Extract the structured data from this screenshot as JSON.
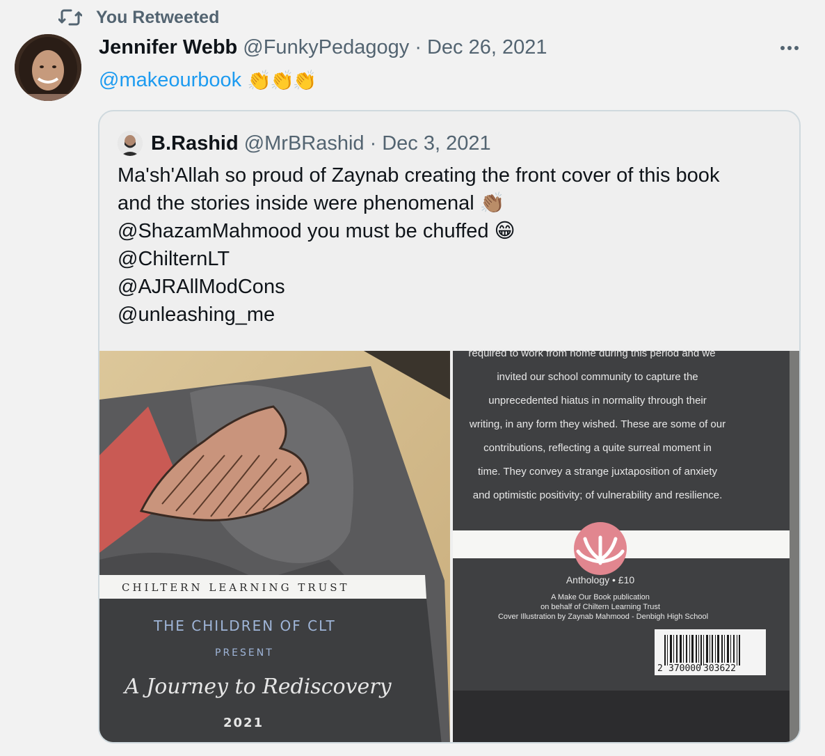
{
  "retweet": {
    "label": "You Retweeted",
    "icon": "retweet-icon"
  },
  "tweet": {
    "author_name": "Jennifer Webb",
    "author_handle": "@FunkyPedagogy",
    "separator": "·",
    "date": "Dec 26, 2021",
    "mention": "@makeourbook",
    "emoji": "👏👏👏",
    "more_icon": "ellipsis-icon"
  },
  "quote": {
    "author_name": "B.Rashid",
    "author_handle": "@MrBRashid",
    "separator": "·",
    "date": "Dec 3, 2021",
    "lines": [
      "Ma'sh'Allah so proud of Zaynab creating the front cover of this book",
      "and the stories inside were phenomenal 👏🏽",
      "@ShazamMahmood you must be chuffed 😁",
      "@ChilternLT",
      "@AJRAllModCons",
      "@unleashing_me"
    ]
  },
  "book_front": {
    "trust": "CHILTERN LEARNING TRUST",
    "line1": "THE CHILDREN OF CLT",
    "line2": "PRESENT",
    "title": "A Journey to Rediscovery",
    "year": "2021"
  },
  "book_back": {
    "blurb": [
      "required to work from home during this period and we",
      "invited our school community to capture the",
      "unprecedented hiatus in normality through their",
      "writing, in any form they wished. These are some of our",
      "contributions, reflecting a quite surreal moment in",
      "time. They convey a strange juxtaposition of anxiety",
      "and optimistic positivity; of vulnerability and resilience."
    ],
    "anthology": "Anthology • £10",
    "pub1": "A Make Our Book publication",
    "pub2": "on behalf of Chiltern Learning Trust",
    "pub3": "Cover Illustration by Zaynab Mahmood - Denbigh High School",
    "barcode_first": "2",
    "barcode_mid": "370000",
    "barcode_last": "303622"
  },
  "colors": {
    "link": "#1d9bf0",
    "secondary": "#536471",
    "logo_pink": "#e1868f",
    "book_dark": "#3a3b3d"
  }
}
